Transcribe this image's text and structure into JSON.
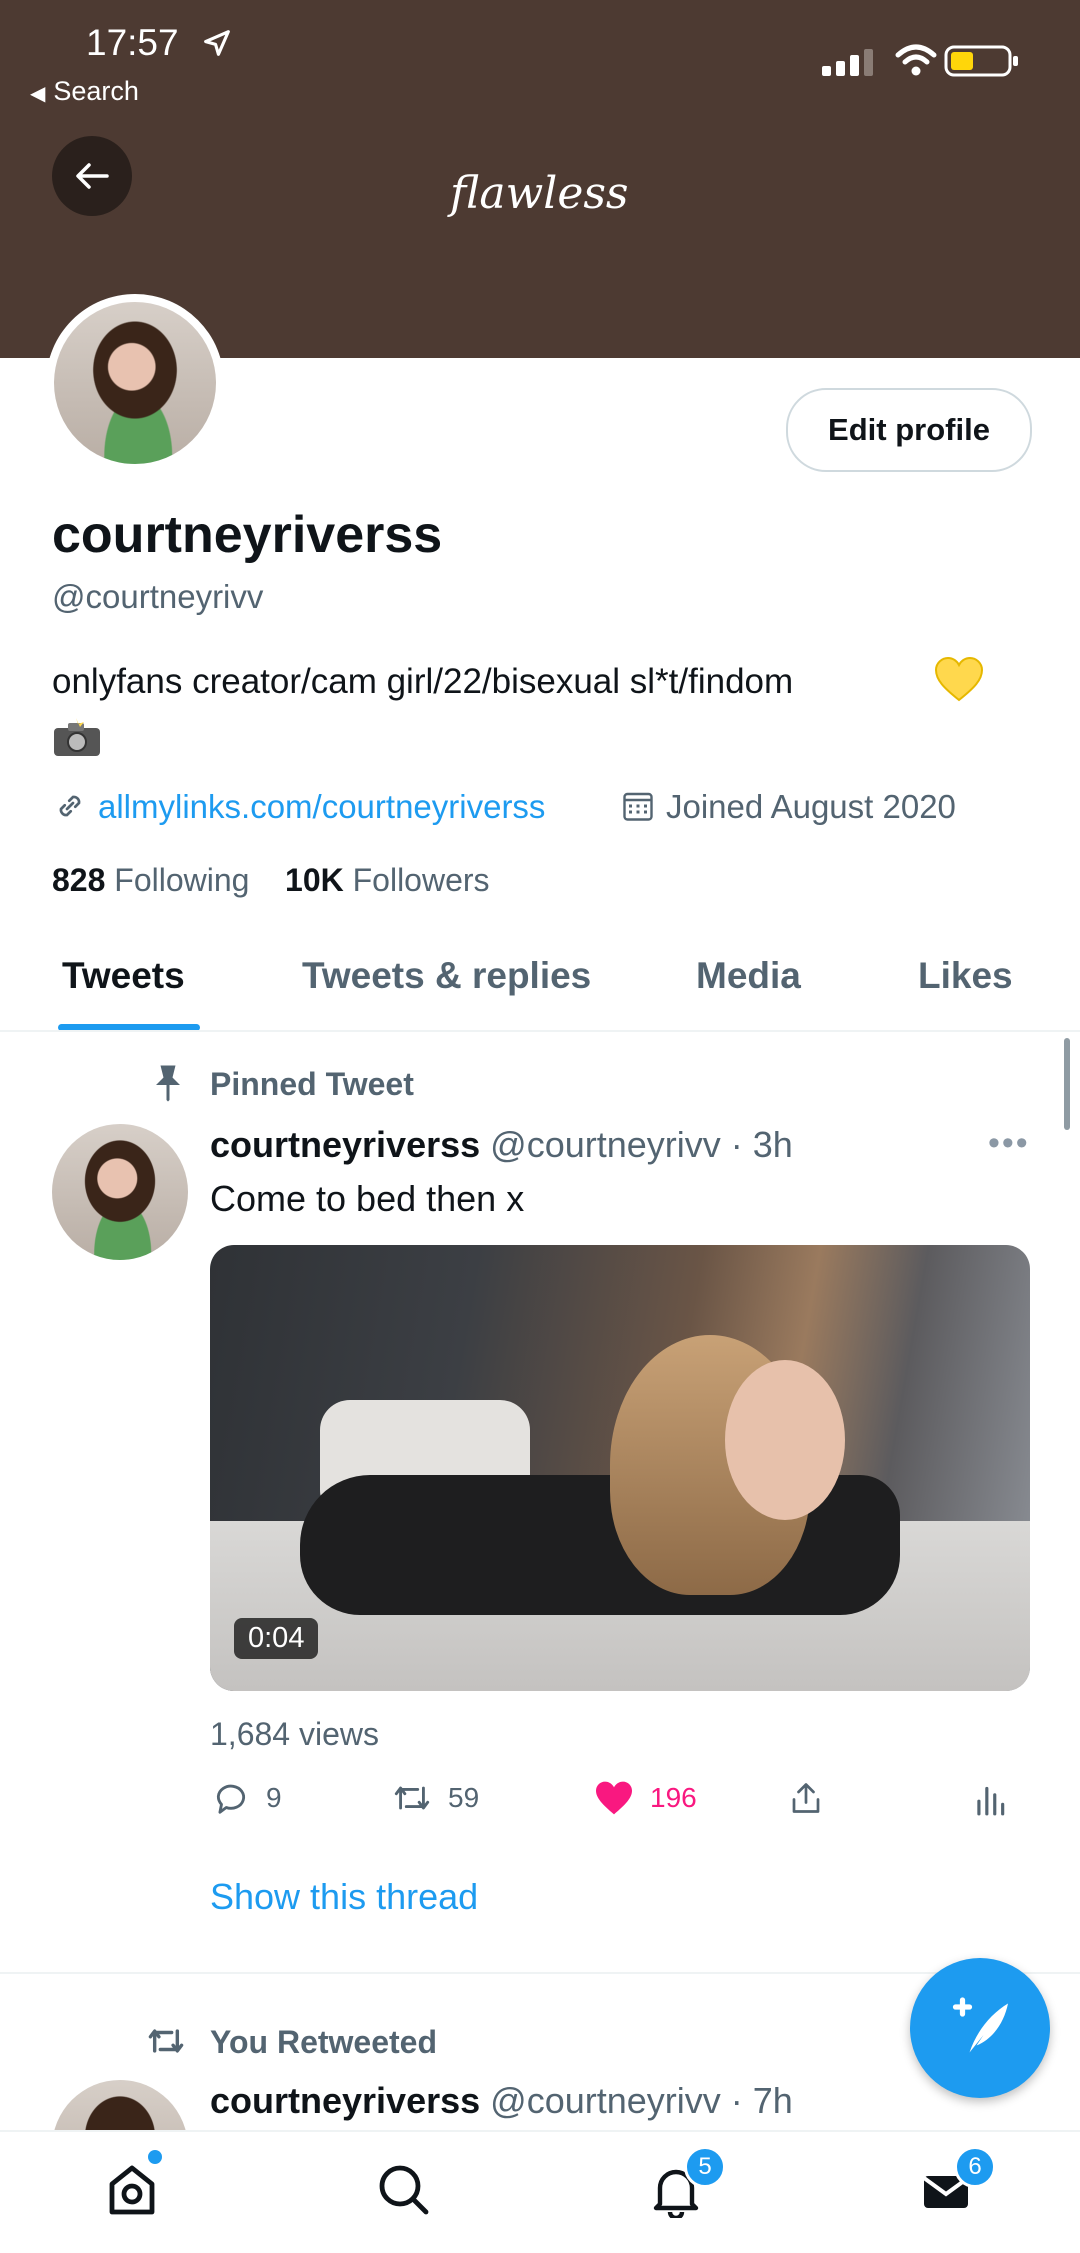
{
  "status_bar": {
    "time": "17:57",
    "back_app": "Search"
  },
  "header": {
    "title": "flawless"
  },
  "profile": {
    "edit_button": "Edit profile",
    "display_name": "courtneyriverss",
    "handle": "@courtneyrivv",
    "bio": "onlyfans creator/cam girl/22/bisexual sl*t/findom",
    "link": "allmylinks.com/courtneyriverss",
    "joined": "Joined August 2020",
    "following_count": "828",
    "following_label": "Following",
    "followers_count": "10K",
    "followers_label": "Followers"
  },
  "tabs": [
    {
      "label": "Tweets",
      "selected": true
    },
    {
      "label": "Tweets & replies"
    },
    {
      "label": "Media"
    },
    {
      "label": "Likes"
    }
  ],
  "pinned_tweet": {
    "pinned_label": "Pinned Tweet",
    "author_name": "courtneyriverss",
    "author_meta": "@courtneyrivv · 3h",
    "text": "Come to bed then x",
    "video_duration": "0:04",
    "views": "1,684 views",
    "replies": "9",
    "retweets": "59",
    "likes": "196",
    "show_thread": "Show this thread"
  },
  "retweeted": {
    "label": "You Retweeted",
    "author_name": "courtneyriverss",
    "author_meta": "@courtneyrivv · 7h"
  },
  "bottom_nav": {
    "notifications_badge": "5",
    "messages_badge": "6"
  },
  "colors": {
    "banner": "#4d3a32",
    "accent": "#1d9bf0",
    "like": "#f91880"
  }
}
